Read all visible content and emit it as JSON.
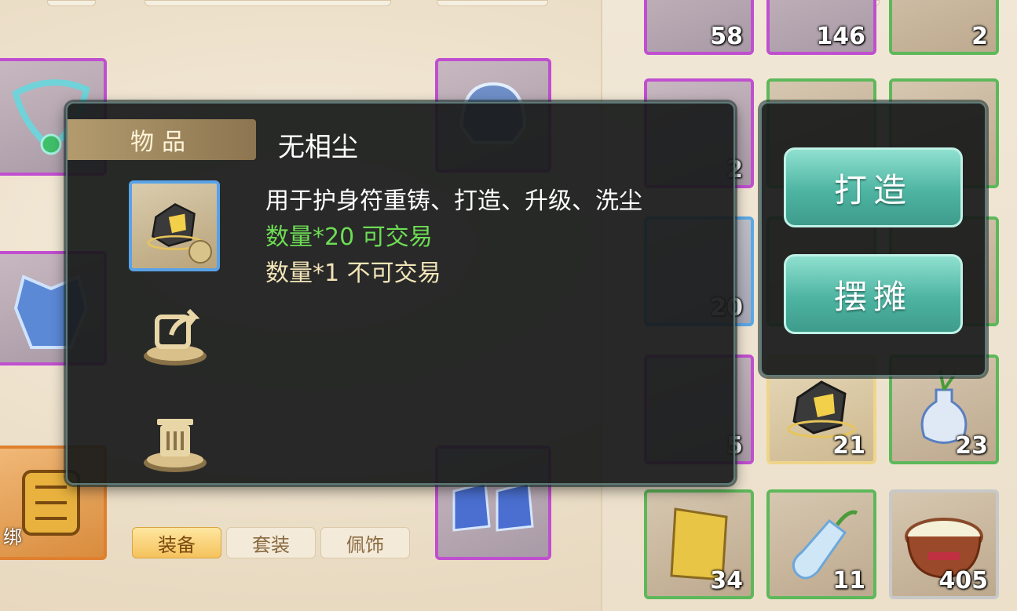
{
  "inventory": {
    "slots": [
      {
        "count": "58",
        "rarity": "purple"
      },
      {
        "count": "146",
        "rarity": "purple"
      },
      {
        "count": "2",
        "rarity": "green"
      },
      {
        "count": "2",
        "rarity": "purple"
      },
      {
        "count": "",
        "rarity": "green"
      },
      {
        "count": "",
        "rarity": "green"
      },
      {
        "count": "20",
        "rarity": "blue"
      },
      {
        "count": "",
        "rarity": "green"
      },
      {
        "count": "",
        "rarity": "green"
      },
      {
        "count": "5",
        "rarity": "purple"
      },
      {
        "count": "21",
        "rarity": "gold"
      },
      {
        "count": "23",
        "rarity": "green"
      },
      {
        "count": "34",
        "rarity": "green"
      },
      {
        "count": "11",
        "rarity": "green"
      },
      {
        "count": "405",
        "rarity": "grey"
      }
    ]
  },
  "equipment": {
    "bind_label": "绑",
    "tabs": [
      {
        "label": "装备",
        "active": true
      },
      {
        "label": "套装",
        "active": false
      },
      {
        "label": "佩饰",
        "active": false
      }
    ]
  },
  "popup": {
    "category": "物品",
    "item_name": "无相尘",
    "description": "用于护身符重铸、打造、升级、洗尘",
    "quantity_tradable": "数量*20 可交易",
    "quantity_untradable": "数量*1 不可交易",
    "icons": [
      "share-icon",
      "trash-icon",
      "zoom-icon"
    ]
  },
  "actions": {
    "forge_label": "打造",
    "stall_label": "摆摊"
  },
  "colors": {
    "tradable": "#6edc55",
    "untradable": "#f2e4b8",
    "action_button": "#4eb4a2",
    "purple_rarity": "#c04fd0",
    "green_rarity": "#5db85a"
  }
}
